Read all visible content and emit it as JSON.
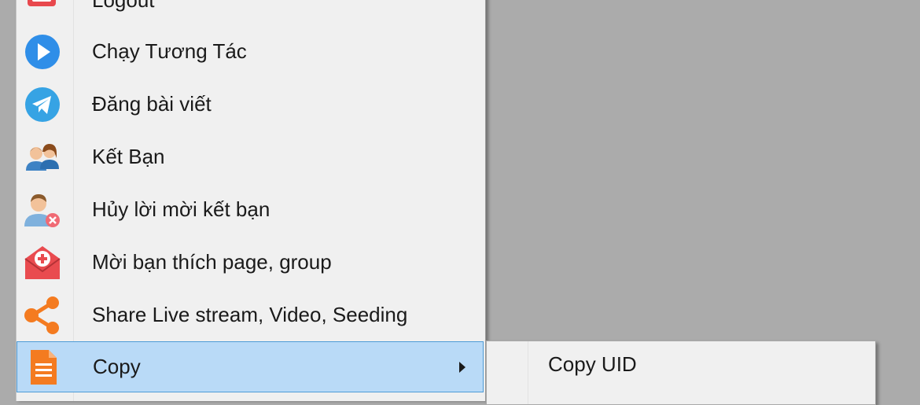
{
  "menu": {
    "items": [
      {
        "label": "Logout",
        "icon": "logout-icon"
      },
      {
        "label": "Chạy Tương Tác",
        "icon": "play-icon"
      },
      {
        "label": "Đăng bài viết",
        "icon": "telegram-send-icon"
      },
      {
        "label": "Kết Bạn",
        "icon": "friends-icon"
      },
      {
        "label": "Hủy lời mời kết bạn",
        "icon": "remove-user-icon"
      },
      {
        "label": "Mời bạn thích page, group",
        "icon": "invite-mail-icon"
      },
      {
        "label": "Share Live stream, Video, Seeding",
        "icon": "share-icon"
      },
      {
        "label": "Copy",
        "icon": "document-icon",
        "selected": true,
        "has_submenu": true
      }
    ]
  },
  "submenu": {
    "items": [
      {
        "label": "Copy UID"
      }
    ]
  },
  "colors": {
    "selected_bg": "#b9daf7",
    "selected_border": "#4e9bd6",
    "desktop_bg": "#ababab"
  }
}
